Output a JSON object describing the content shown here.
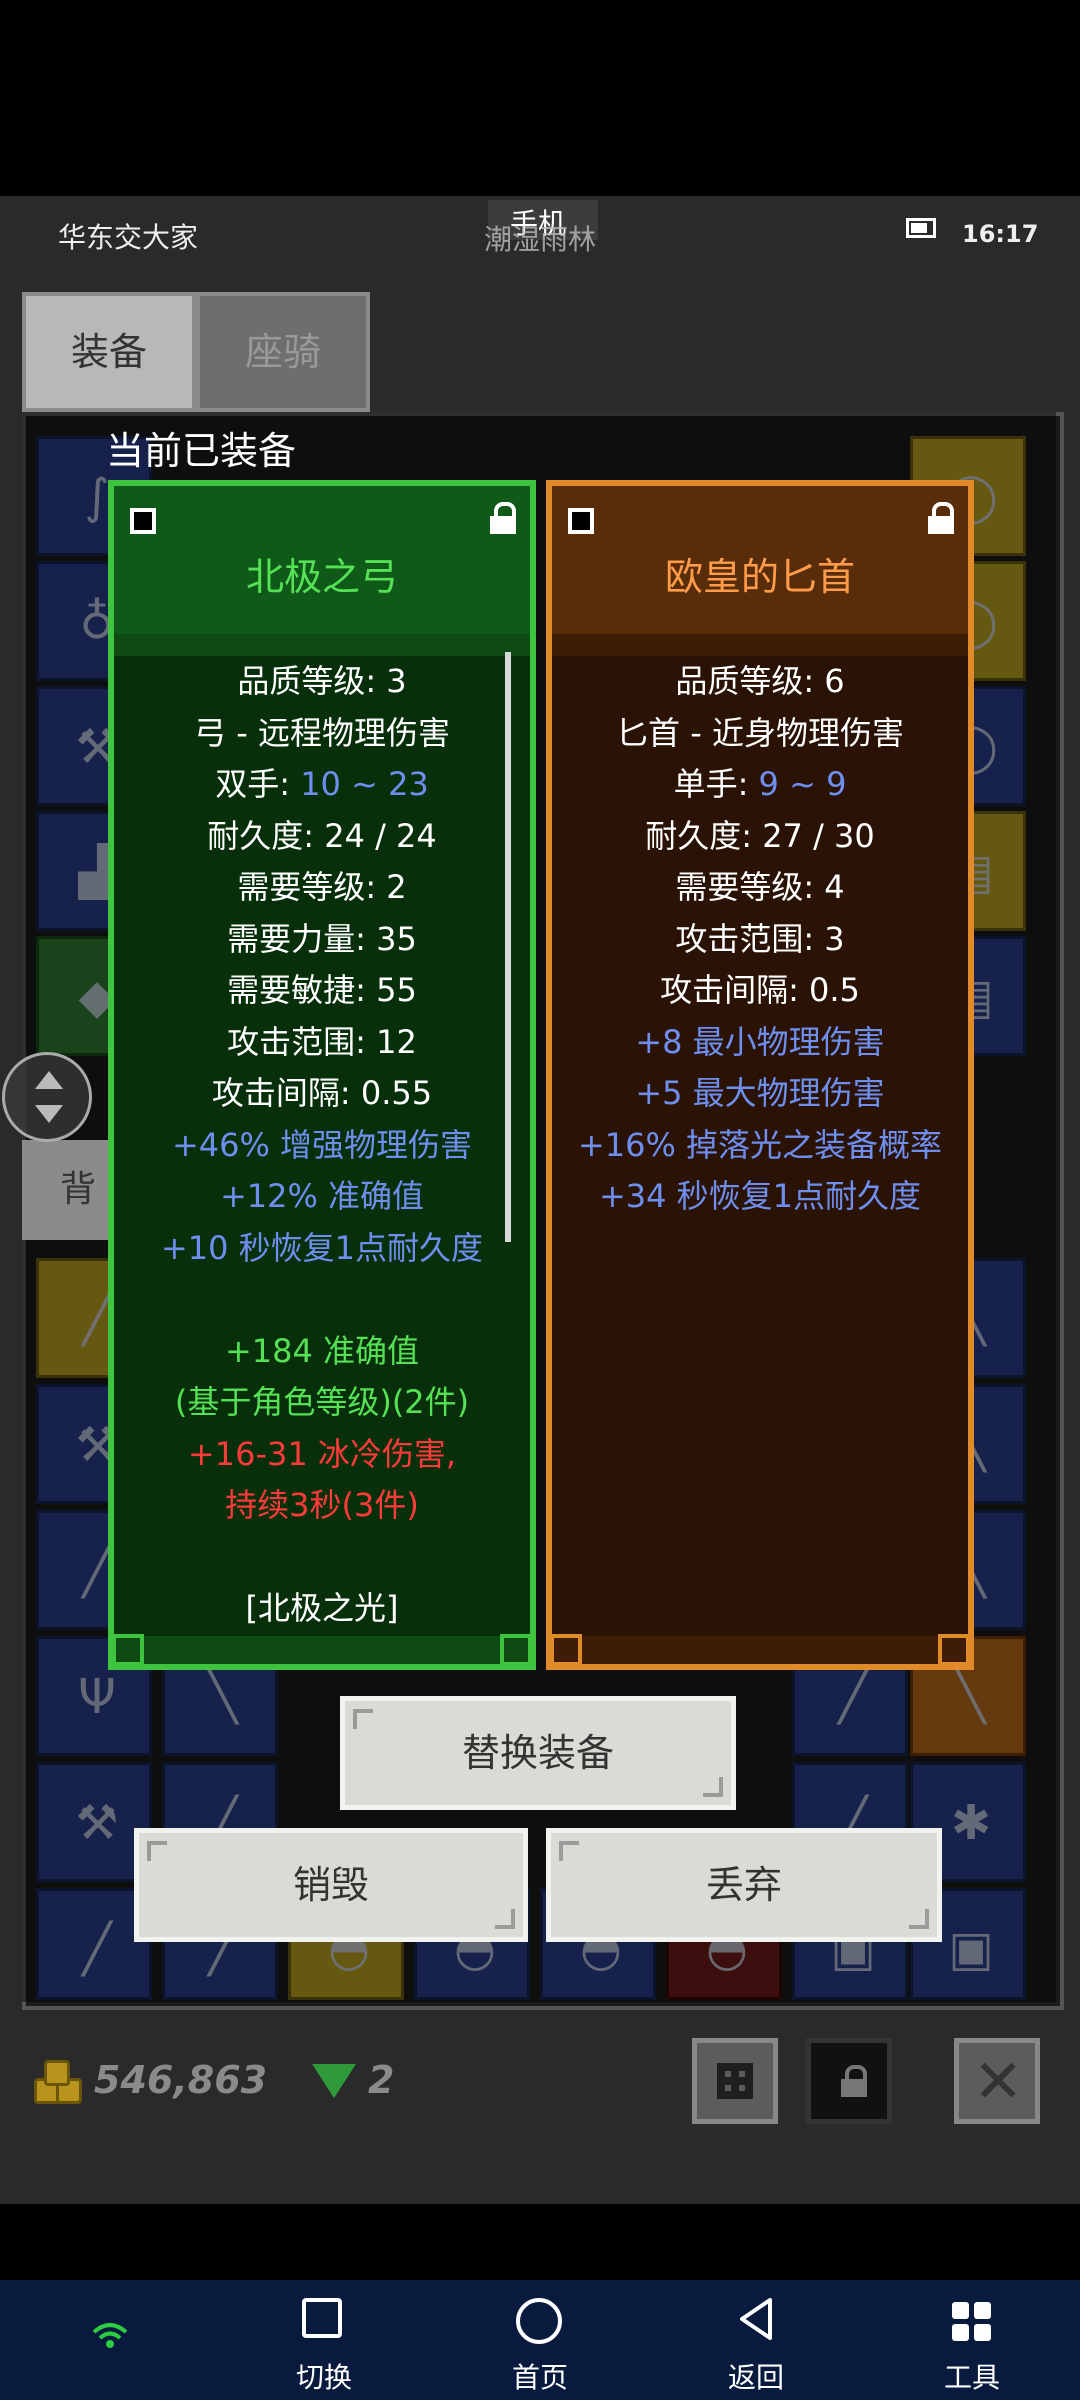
{
  "statusbar": {
    "carrier": "华东交大家",
    "overlay_top": "手机",
    "overlay_bottom": "潮湿雨林",
    "time": "16:17"
  },
  "tabs": [
    "装备",
    "座骑"
  ],
  "side_tab_partial": "背",
  "modal": {
    "heading": "当前已装备",
    "left_card": {
      "title": "北极之弓",
      "rarity_color": "#3ec43e",
      "lines": [
        {
          "text": "品质等级: 3",
          "color": "white"
        },
        {
          "text": "弓 - 远程物理伤害",
          "color": "white"
        },
        {
          "text": "双手: ",
          "color": "white",
          "value": "10 ~ 23"
        },
        {
          "text": "耐久度: 24 / 24",
          "color": "white"
        },
        {
          "text": "需要等级: 2",
          "color": "white"
        },
        {
          "text": "需要力量: 35",
          "color": "white"
        },
        {
          "text": "需要敏捷: 55",
          "color": "white"
        },
        {
          "text": "攻击范围: 12",
          "color": "white"
        },
        {
          "text": "攻击间隔: 0.55",
          "color": "white"
        },
        {
          "text": "+46% 增强物理伤害",
          "color": "blue"
        },
        {
          "text": "+12% 准确值",
          "color": "blue"
        },
        {
          "text": "+10 秒恢复1点耐久度",
          "color": "blue"
        },
        {
          "text": "",
          "color": "blank"
        },
        {
          "text": "+184 准确值",
          "color": "green"
        },
        {
          "text": "(基于角色等级)(2件)",
          "color": "green"
        },
        {
          "text": "+16-31 冰冷伤害,",
          "color": "red"
        },
        {
          "text": "持续3秒(3件)",
          "color": "red"
        },
        {
          "text": "",
          "color": "blank"
        },
        {
          "text": "[北极之光]",
          "color": "white"
        }
      ]
    },
    "right_card": {
      "title": "欧皇的匕首",
      "rarity_color": "#e08a2a",
      "lines": [
        {
          "text": "品质等级: 6",
          "color": "white"
        },
        {
          "text": "匕首 - 近身物理伤害",
          "color": "white"
        },
        {
          "text": "单手: ",
          "color": "white",
          "value": "9 ~ 9"
        },
        {
          "text": "耐久度: 27 / 30",
          "color": "white"
        },
        {
          "text": "需要等级: 4",
          "color": "white"
        },
        {
          "text": "攻击范围: 3",
          "color": "white"
        },
        {
          "text": "攻击间隔: 0.5",
          "color": "white"
        },
        {
          "text": "+8 最小物理伤害",
          "color": "blue"
        },
        {
          "text": "+5 最大物理伤害",
          "color": "blue"
        },
        {
          "text": "+16% 掉落光之装备概率",
          "color": "blue"
        },
        {
          "text": "+34 秒恢复1点耐久度",
          "color": "blue"
        }
      ]
    },
    "buttons": {
      "replace": "替换装备",
      "destroy": "销毁",
      "discard": "丢弃"
    }
  },
  "currency": {
    "gold": "546,863",
    "gems": "2"
  },
  "sysnav": {
    "switch": "切换",
    "home": "首页",
    "back": "返回",
    "tools": "工具"
  }
}
